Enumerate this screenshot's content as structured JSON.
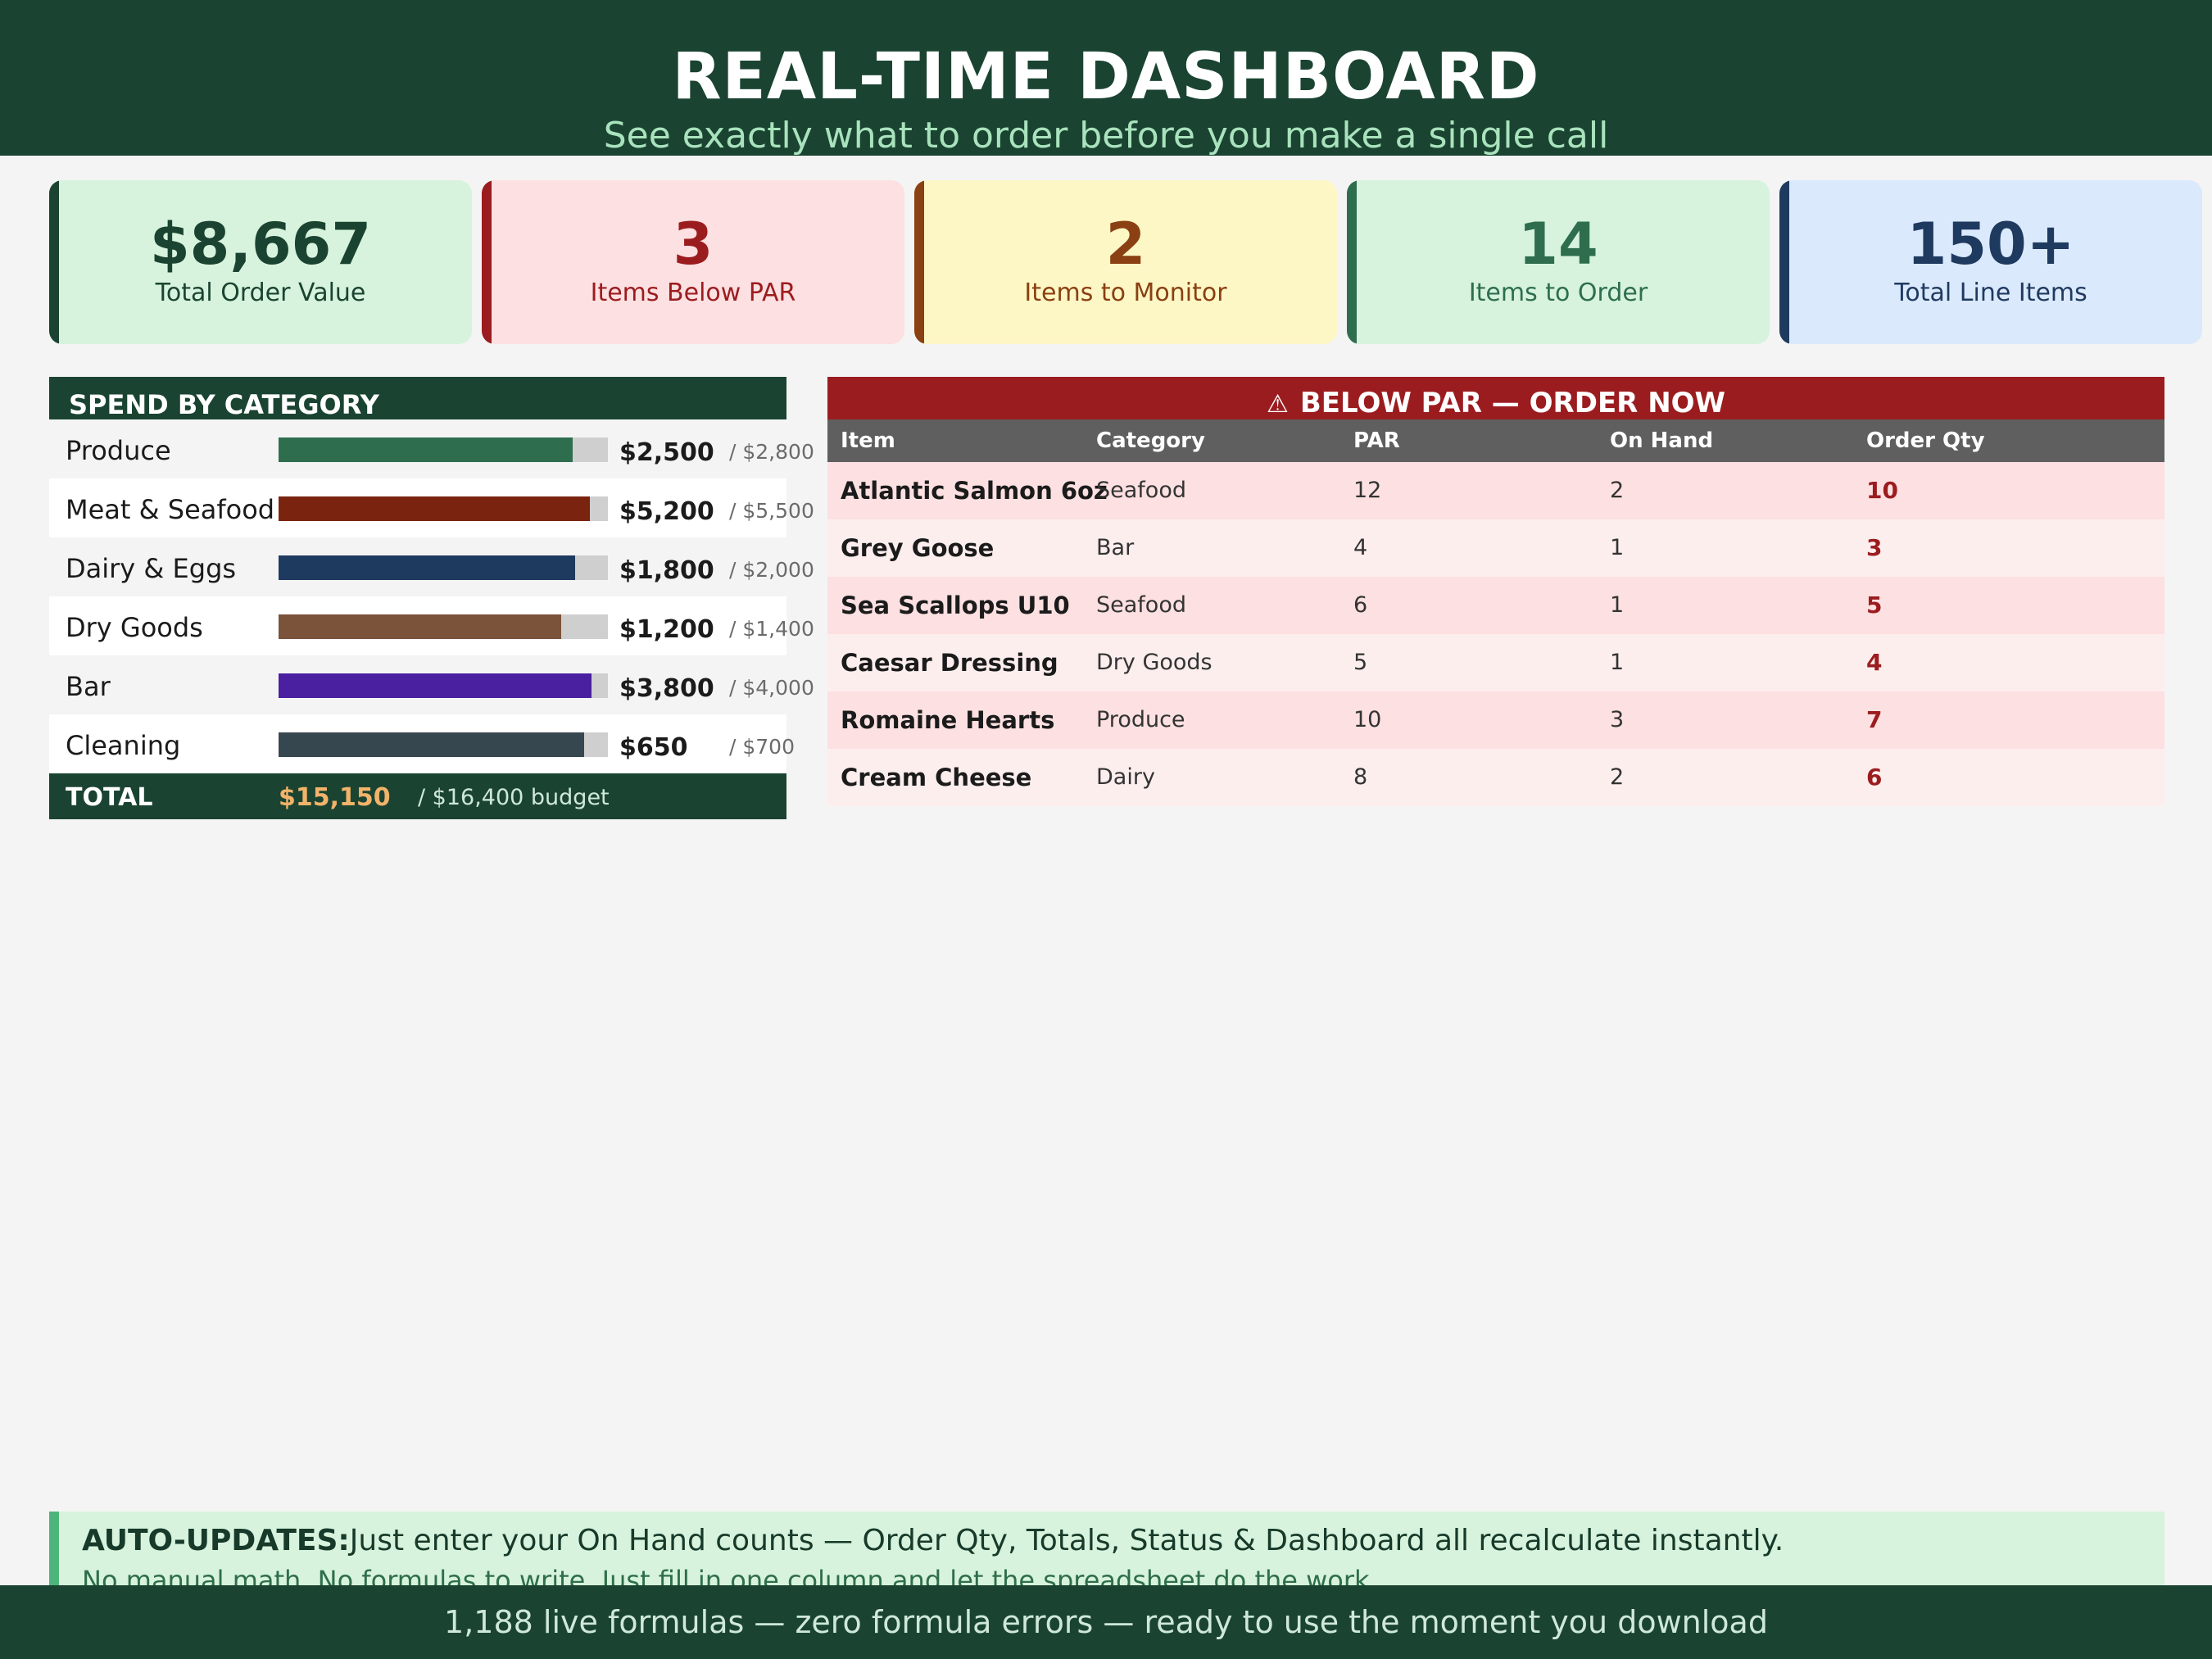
{
  "header": {
    "title": "REAL-TIME DASHBOARD",
    "subtitle": "See exactly what to order before you make a single call"
  },
  "kpis": [
    {
      "value": "$8,667",
      "label": "Total Order Value",
      "accent": "#1a4431",
      "bg": "#d7f3dd",
      "value_color": "#1a4431",
      "label_color": "#1a4431"
    },
    {
      "value": "3",
      "label": "Items Below PAR",
      "accent": "#9b1c1f",
      "bg": "#fde0e1",
      "value_color": "#9b1c1f",
      "label_color": "#9b1c1f"
    },
    {
      "value": "2",
      "label": "Items to Monitor",
      "accent": "#8a4012",
      "bg": "#fdf7c6",
      "value_color": "#8a4012",
      "label_color": "#8a4012"
    },
    {
      "value": "14",
      "label": "Items to Order",
      "accent": "#2e6e4f",
      "bg": "#d7f3dd",
      "value_color": "#2e6e4f",
      "label_color": "#2e6e4f"
    },
    {
      "value": "150+",
      "label": "Total Line Items",
      "accent": "#1f3a5f",
      "bg": "#dbe9fd",
      "value_color": "#1f3a5f",
      "label_color": "#1f3a5f"
    }
  ],
  "spend": {
    "title": "SPEND BY CATEGORY",
    "categories": [
      {
        "name": "Produce",
        "amount": "$2,500",
        "budget": "/ $2,800",
        "fraction": 0.893,
        "color": "#2e6e4f"
      },
      {
        "name": "Meat & Seafood",
        "amount": "$5,200",
        "budget": "/ $5,500",
        "fraction": 0.945,
        "color": "#7a2410"
      },
      {
        "name": "Dairy & Eggs",
        "amount": "$1,800",
        "budget": "/ $2,000",
        "fraction": 0.9,
        "color": "#1f3a5f"
      },
      {
        "name": "Dry Goods",
        "amount": "$1,200",
        "budget": "/ $1,400",
        "fraction": 0.857,
        "color": "#7a533a"
      },
      {
        "name": "Bar",
        "amount": "$3,800",
        "budget": "/ $4,000",
        "fraction": 0.95,
        "color": "#4a1fa0"
      },
      {
        "name": "Cleaning",
        "amount": "$650",
        "budget": "/ $700",
        "fraction": 0.929,
        "color": "#37474f"
      }
    ],
    "total_label": "TOTAL",
    "total_amount": "$15,150",
    "total_budget": "/ $16,400 budget"
  },
  "below_par": {
    "icon": "⚠",
    "title": "BELOW PAR — ORDER NOW",
    "columns": [
      "Item",
      "Category",
      "PAR",
      "On Hand",
      "Order Qty"
    ],
    "rows": [
      [
        "Atlantic Salmon 6oz",
        "Seafood",
        "12",
        "2",
        "10"
      ],
      [
        "Grey Goose",
        "Bar",
        "4",
        "1",
        "3"
      ],
      [
        "Sea Scallops U10",
        "Seafood",
        "6",
        "1",
        "5"
      ],
      [
        "Caesar Dressing",
        "Dry Goods",
        "5",
        "1",
        "4"
      ],
      [
        "Romaine Hearts",
        "Produce",
        "10",
        "3",
        "7"
      ],
      [
        "Cream Cheese",
        "Dairy",
        "8",
        "2",
        "6"
      ]
    ]
  },
  "auto_updates": {
    "label": "AUTO-UPDATES:",
    "text": "Just enter your On Hand counts — Order Qty, Totals, Status & Dashboard all recalculate instantly.",
    "subtext": "No manual math. No formulas to write. Just fill in one column and let the spreadsheet do the work."
  },
  "footer": {
    "text": "1,188 live formulas — zero formula errors — ready to use the moment you download"
  }
}
